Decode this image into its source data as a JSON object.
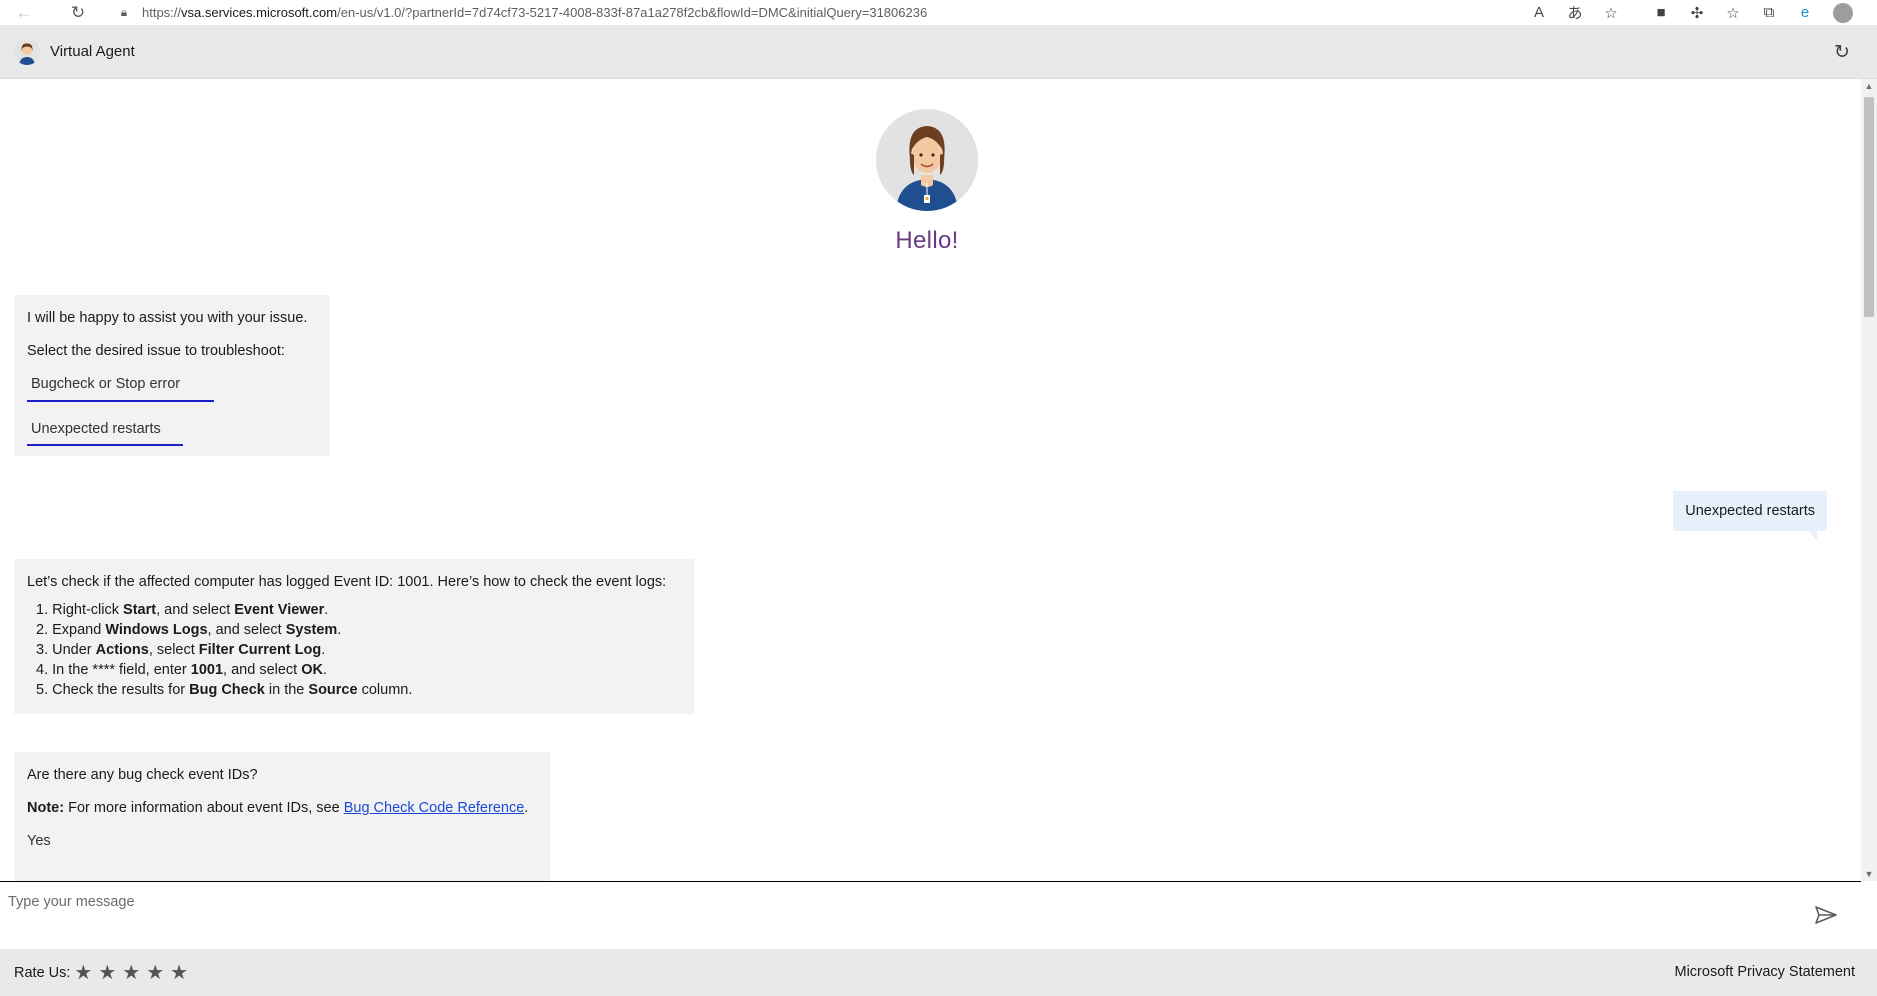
{
  "browser": {
    "url_prefix": "https://",
    "url_host": "vsa.services.microsoft.com",
    "url_rest": "/en-us/v1.0/?partnerId=7d74cf73-5217-4008-833f-87a1a278f2cb&flowId=DMC&initialQuery=31806236"
  },
  "header": {
    "title": "Virtual Agent"
  },
  "hero": {
    "greeting": "Hello!"
  },
  "messages": {
    "intro": {
      "line1": "I will be happy to assist you with your issue.",
      "line2": "Select the desired issue to troubleshoot:",
      "choices": [
        "Bugcheck or Stop error",
        "Unexpected restarts"
      ]
    },
    "user_reply": "Unexpected restarts",
    "event_check": {
      "intro": "Let’s check if the affected computer has logged Event ID: 1001. Here’s how to check the event logs:",
      "steps": [
        {
          "n": "1.",
          "a": "Right-click ",
          "b": "Start",
          "c": ", and select ",
          "d": "Event Viewer",
          "e": "."
        },
        {
          "n": "2.",
          "a": "Expand ",
          "b": "Windows Logs",
          "c": ", and select ",
          "d": "System",
          "e": "."
        },
        {
          "n": "3.",
          "a": "Under ",
          "b": "Actions",
          "c": ", select ",
          "d": "Filter Current Log",
          "e": "."
        },
        {
          "n": "4.",
          "a": "In the **** field, enter ",
          "b": "1001",
          "c": ", and select ",
          "d": "OK",
          "e": "."
        },
        {
          "n": "5.",
          "a": "Check the results for ",
          "b": "Bug Check",
          "c": " in the ",
          "d": "Source",
          "e": " column."
        }
      ]
    },
    "bug_check_question": {
      "question": "Are there any bug check event IDs?",
      "note_label": "Note:",
      "note_text": " For more information about event IDs, see ",
      "note_link": "Bug Check Code Reference",
      "note_end": ".",
      "answer": "Yes"
    }
  },
  "input": {
    "placeholder": "Type your message"
  },
  "footer": {
    "rate_label": "Rate Us:",
    "stars": 5,
    "privacy": "Microsoft Privacy Statement"
  },
  "colors": {
    "greeting": "#6b3b86",
    "choice_underline": "#1e1ecb",
    "user_bubble": "#e6f1fb",
    "bot_card": "#f2f2f2",
    "header_bg": "#e9e9e9"
  }
}
